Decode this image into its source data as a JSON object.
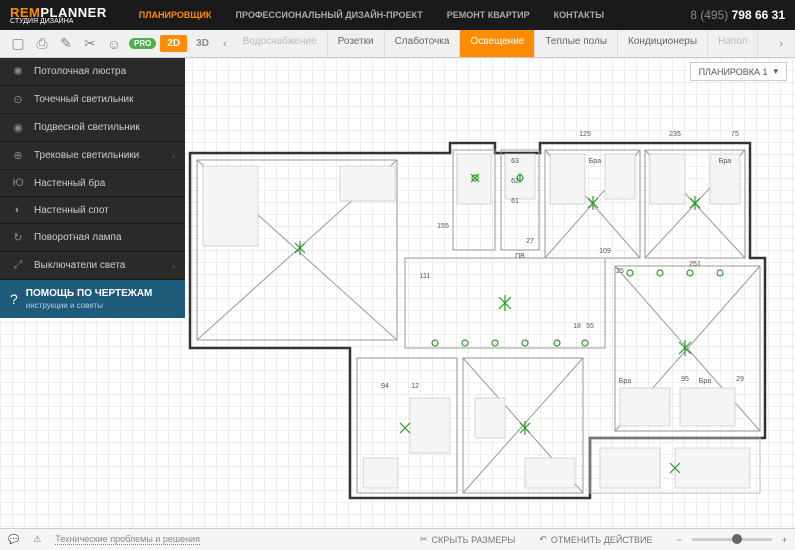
{
  "header": {
    "logo_rem": "REM",
    "logo_planner": "PLANNER",
    "logo_sub": "СТУДИЯ ДИЗАЙНА",
    "nav": [
      "ПЛАНИРОВЩИК",
      "ПРОФЕССИОНАЛЬНЫЙ ДИЗАЙН-ПРОЕКТ",
      "РЕМОНТ КВАРТИР",
      "КОНТАКТЫ"
    ],
    "phone_prefix": "8 (495) ",
    "phone": "798 66 31"
  },
  "toolbar": {
    "pro": "PRO",
    "view2d": "2D",
    "view3d": "3D",
    "tabs": [
      "Водоснабжение",
      "Розетки",
      "Слаботочка",
      "Освещение",
      "Теплые полы",
      "Кондиционеры",
      "Напол"
    ]
  },
  "sidebar": {
    "items": [
      {
        "label": "Потолочная люстра"
      },
      {
        "label": "Точечный светильник"
      },
      {
        "label": "Подвесной светильник"
      },
      {
        "label": "Трековые светильники",
        "arrow": true
      },
      {
        "label": "Настенный бра"
      },
      {
        "label": "Настенный спот"
      },
      {
        "label": "Поворотная лампа"
      },
      {
        "label": "Выключатели света",
        "arrow": true
      }
    ],
    "help_title": "ПОМОЩЬ ПО ЧЕРТЕЖАМ",
    "help_sub": "инструкции и советы"
  },
  "layout_dd": "ПЛАНИРОВКА 1",
  "dimensions": {
    "d1": "125",
    "d2": "235",
    "d3": "75",
    "d4": "155",
    "d5": "27",
    "d6": "111",
    "d7": "109",
    "d8": "251",
    "d9": "18",
    "d10": "55",
    "d11": "94",
    "d12": "12",
    "d13": "95",
    "d14": "29",
    "d15": "25",
    "d16": "63",
    "d17": "62",
    "d18": "61",
    "d19": "Бра",
    "d20": "ПВ"
  },
  "status": {
    "tech": "Технические проблемы и решения",
    "hide_dims": "СКРЫТЬ РАЗМЕРЫ",
    "undo": "ОТМЕНИТЬ ДЕЙСТВИЕ",
    "minus": "−",
    "plus": "+"
  }
}
